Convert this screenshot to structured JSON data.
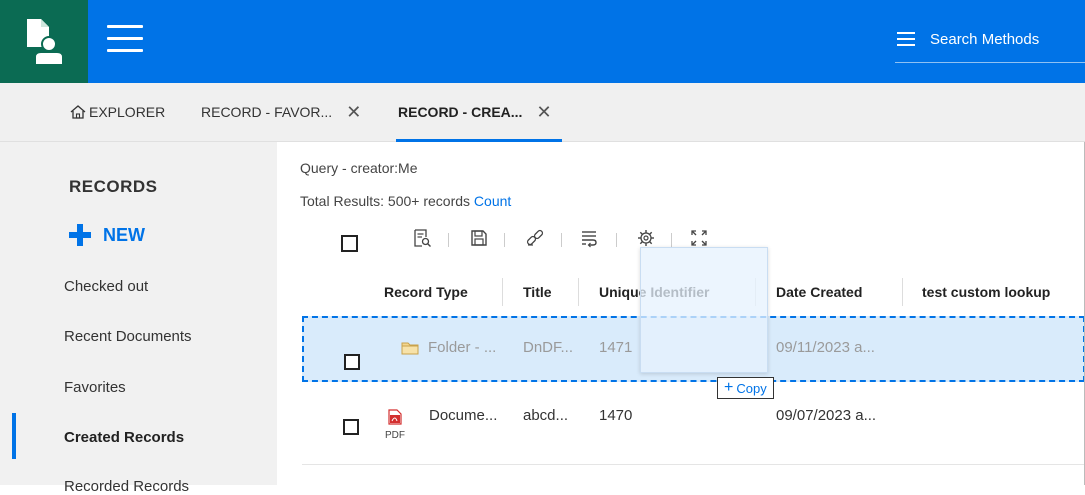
{
  "header": {
    "search_placeholder": "Search Methods"
  },
  "tabs": [
    {
      "label": "EXPLORER"
    },
    {
      "label": "RECORD - FAVOR...",
      "close": "✕"
    },
    {
      "label": "RECORD - CREA...",
      "close": "✕",
      "active": true
    }
  ],
  "sidebar": {
    "title": "RECORDS",
    "new_label": "NEW",
    "items": [
      {
        "label": "Checked out"
      },
      {
        "label": "Recent Documents"
      },
      {
        "label": "Favorites"
      },
      {
        "label": "Created Records",
        "active": true
      },
      {
        "label": "Recorded Records"
      }
    ]
  },
  "main": {
    "query": "Query - creator:Me",
    "total_prefix": "Total Results: 500+ records",
    "count_link": "Count",
    "toolbar": [
      "search-record-icon",
      "save-icon",
      "link-icon",
      "wrap-text-icon",
      "settings-icon",
      "expand-icon"
    ],
    "columns": [
      "Record Type",
      "Title",
      "Unique Identifier",
      "Date Created",
      "test custom lookup"
    ],
    "rows": [
      {
        "type": "Folder - ...",
        "title": "DnDF...",
        "uid": "1471",
        "date": "09/11/2023 a...",
        "custom": "",
        "selected": true
      },
      {
        "type": "Docume...",
        "type_sub": "PDF",
        "title": "abcd...",
        "uid": "1470",
        "date": "09/07/2023 a...",
        "custom": ""
      }
    ],
    "drag_tooltip": "Copy"
  },
  "colors": {
    "primary": "#0073e7",
    "logo_bg": "#0b6b53",
    "selected_row": "#d9ebfb"
  }
}
